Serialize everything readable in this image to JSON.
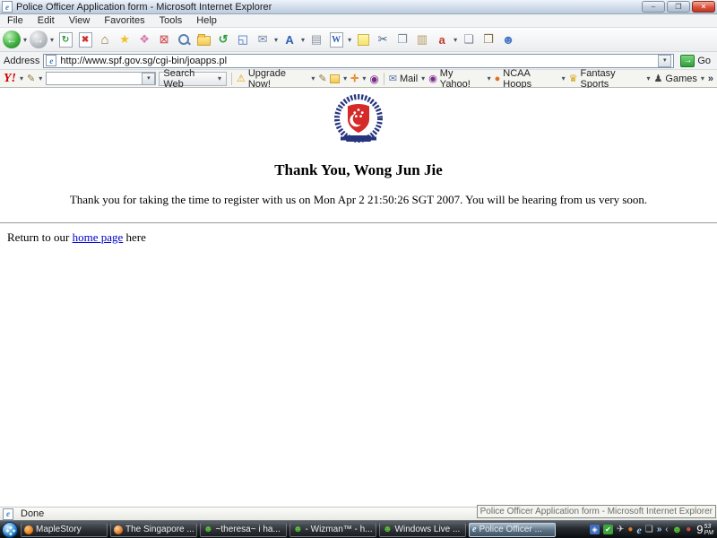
{
  "ui": {
    "caret": "▾",
    "drop": "▼",
    "chevron": "»",
    "back_chevron": "‹"
  },
  "window": {
    "title": "Police Officer Application form - Microsoft Internet Explorer",
    "icon_glyph": "e",
    "minimize_glyph": "–",
    "restore_glyph": "❐",
    "close_glyph": "✕"
  },
  "menu": {
    "items": [
      "File",
      "Edit",
      "View",
      "Favorites",
      "Tools",
      "Help"
    ]
  },
  "toolbar": {
    "icons": [
      {
        "name": "back",
        "glyph": "←"
      },
      {
        "name": "forward",
        "glyph": "→"
      },
      {
        "name": "refresh",
        "glyph": "↻"
      },
      {
        "name": "stop",
        "glyph": "✖"
      },
      {
        "name": "home",
        "glyph": "⌂"
      },
      {
        "name": "favorites",
        "glyph": "★"
      },
      {
        "name": "add-page",
        "glyph": "❖"
      },
      {
        "name": "remove-page",
        "glyph": "⊠"
      },
      {
        "name": "search",
        "glyph": ""
      },
      {
        "name": "folders",
        "glyph": ""
      },
      {
        "name": "history",
        "glyph": "↺"
      },
      {
        "name": "fullscreen",
        "glyph": "◱"
      },
      {
        "name": "mail",
        "glyph": "✉"
      },
      {
        "name": "font-size",
        "glyph": "A"
      },
      {
        "name": "print",
        "glyph": "▤"
      },
      {
        "name": "edit-word",
        "glyph": "W"
      },
      {
        "name": "notes",
        "glyph": ""
      },
      {
        "name": "cut",
        "glyph": "✂"
      },
      {
        "name": "copy",
        "glyph": "❐"
      },
      {
        "name": "paste",
        "glyph": "▥"
      },
      {
        "name": "translate",
        "glyph": "a"
      },
      {
        "name": "preview",
        "glyph": "❏"
      },
      {
        "name": "research",
        "glyph": "❒"
      },
      {
        "name": "messenger",
        "glyph": "☻"
      }
    ]
  },
  "address": {
    "label": "Address",
    "url": "http://www.spf.gov.sg/cgi-bin/joapps.pl",
    "go_label": "Go",
    "go_glyph": "→"
  },
  "yahoo": {
    "logo": "Y!",
    "pencil_glyph": "✎",
    "search_value": "",
    "search_button": "Search Web",
    "upgrade_label": "Upgrade Now!",
    "warning_glyph": "⚠",
    "plus_glyph": "✛",
    "items": [
      {
        "label": "Mail",
        "glyph": "✉"
      },
      {
        "label": "My Yahoo!",
        "glyph": "◉"
      },
      {
        "label": "NCAA Hoops",
        "glyph": "●"
      },
      {
        "label": "Fantasy Sports",
        "glyph": "♛"
      },
      {
        "label": "Games",
        "glyph": "♟"
      }
    ]
  },
  "page": {
    "heading": "Thank You, Wong Jun Jie",
    "message": "Thank you for taking the time to register with us on Mon Apr 2 21:50:26 SGT 2007. You will be hearing from us very soon.",
    "return_prefix": "Return to our ",
    "return_link": "home page",
    "return_suffix": " here",
    "crest_colors": {
      "wreath": "#26357e",
      "shield": "#d42a28",
      "emblem": "#ffffff"
    }
  },
  "status": {
    "text": "Done",
    "tooltip": "Police Officer Application form - Microsoft Internet Explorer"
  },
  "taskbar": {
    "tasks": [
      {
        "label": "MapleStory",
        "icon": "maplestory"
      },
      {
        "label": "The Singapore ...",
        "icon": "firefox"
      },
      {
        "label": "~theresa~ i ha...",
        "icon": "msn-messenger"
      },
      {
        "label": "- Wizman™ - h...",
        "icon": "msn-messenger"
      },
      {
        "label": "Windows Live ...",
        "icon": "windows-live"
      },
      {
        "label": "Police Officer ...",
        "icon": "internet-explorer",
        "active": true
      }
    ],
    "tray_icons": [
      {
        "name": "app-blue",
        "glyph": "◈"
      },
      {
        "name": "security-shield",
        "glyph": "✔"
      },
      {
        "name": "airplane",
        "glyph": "✈"
      },
      {
        "name": "firefox",
        "glyph": "●"
      },
      {
        "name": "internet-explorer",
        "glyph": "e"
      },
      {
        "name": "document",
        "glyph": "❏"
      },
      {
        "name": "messenger",
        "glyph": "☻"
      },
      {
        "name": "volume-red",
        "glyph": "●"
      }
    ],
    "clock": {
      "hour": "9",
      "minute": "53",
      "period": "PM"
    }
  }
}
